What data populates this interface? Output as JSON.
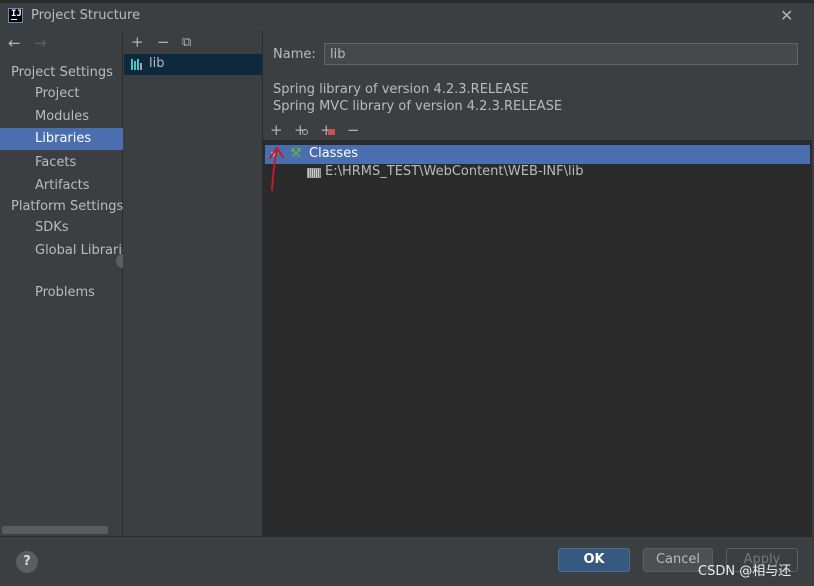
{
  "window": {
    "title": "Project Structure",
    "close_glyph": "✕",
    "app_icon_letters": "IJ"
  },
  "sidebar": {
    "back_glyph": "←",
    "forward_glyph": "→",
    "project_settings_header": "Project Settings",
    "project_settings_items": [
      "Project",
      "Modules",
      "Libraries",
      "Facets",
      "Artifacts"
    ],
    "platform_settings_header": "Platform Settings",
    "platform_settings_items": [
      "SDKs",
      "Global Libraries"
    ],
    "problems": "Problems",
    "selected": "Libraries"
  },
  "libraries_panel": {
    "add_glyph": "+",
    "remove_glyph": "−",
    "copy_glyph": "⧉",
    "items": [
      {
        "label": "lib",
        "icon": "library-icon"
      }
    ]
  },
  "details": {
    "name_label": "Name:",
    "name_value": "lib",
    "descriptions": [
      "Spring library of version 4.2.3.RELEASE",
      "Spring MVC library of version 4.2.3.RELEASE"
    ],
    "toolbar": {
      "add_glyph": "+",
      "add_jar_glyph": "+",
      "add_native_glyph": "+",
      "remove_glyph": "−"
    },
    "tree": {
      "root_label": "Classes",
      "root_icon": "hammer-icon",
      "children": [
        "E:\\HRMS_TEST\\WebContent\\WEB-INF\\lib"
      ]
    }
  },
  "buttons": {
    "help": "?",
    "ok": "OK",
    "cancel": "Cancel",
    "apply": "Apply"
  },
  "watermark": "CSDN @相与还",
  "colors": {
    "background": "#3c3f41",
    "selection": "#4b6eaf",
    "ok_button": "#365880",
    "annotation_arrow": "#c01c28"
  }
}
